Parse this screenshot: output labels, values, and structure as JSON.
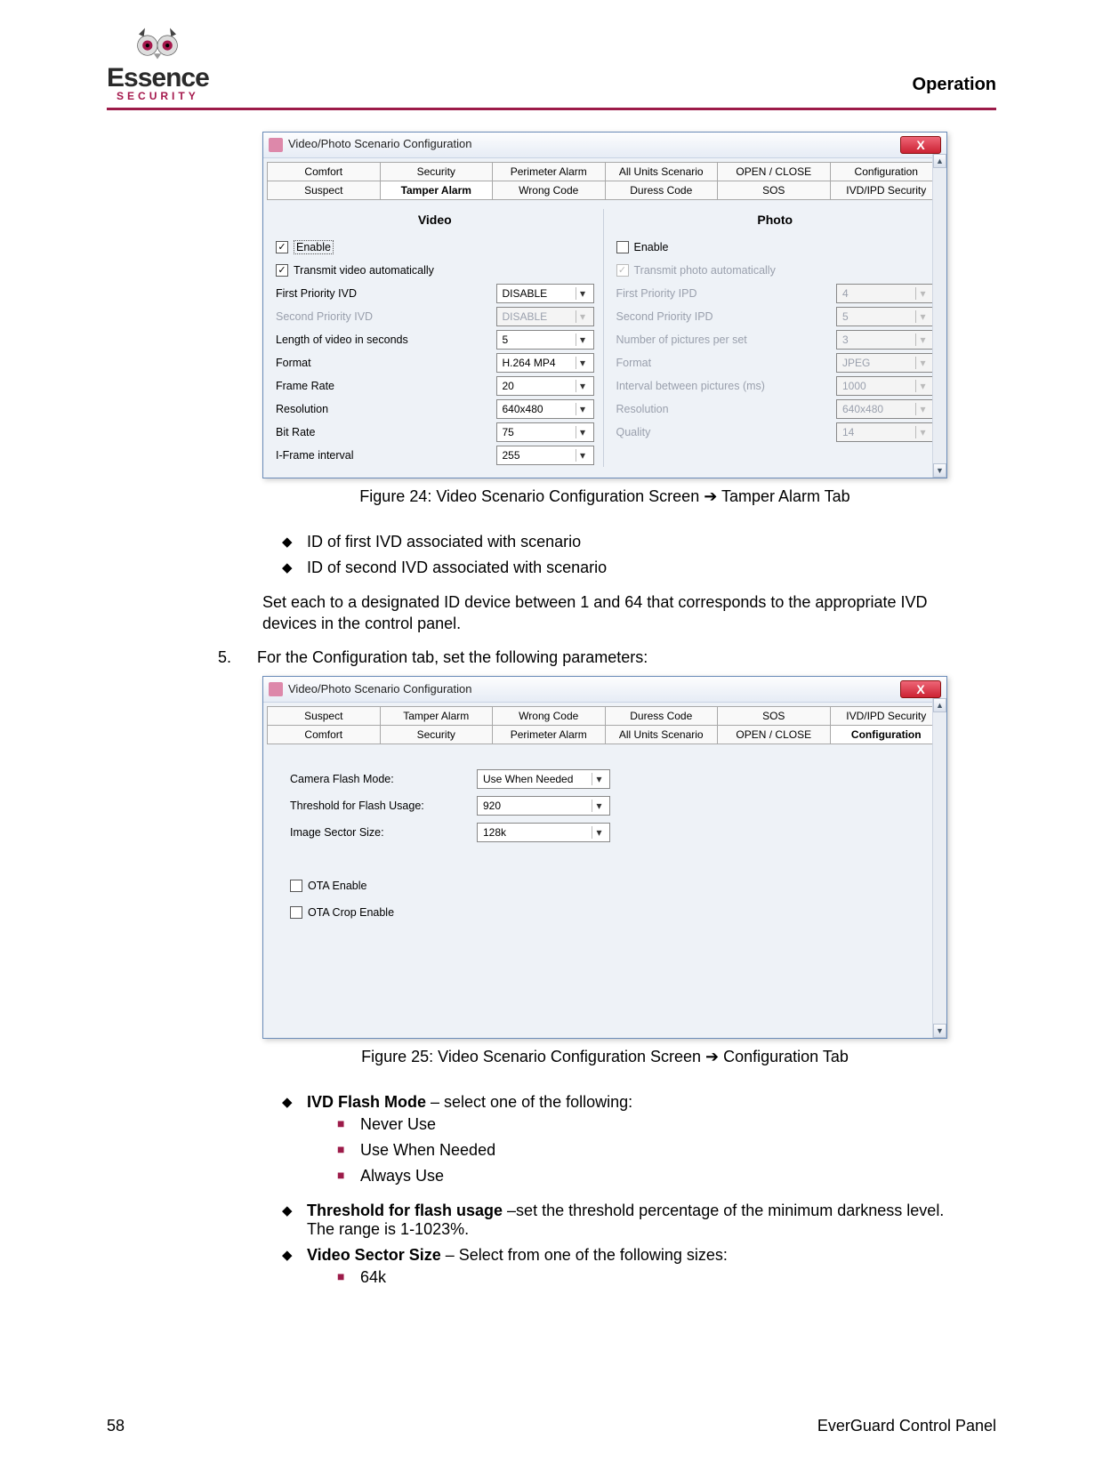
{
  "header": {
    "brand_line1": "Essence",
    "brand_line2": "SECURITY",
    "section": "Operation"
  },
  "dialog1": {
    "title": "Video/Photo Scenario Configuration",
    "tabs_row1": [
      "Comfort",
      "Security",
      "Perimeter Alarm",
      "All Units Scenario",
      "OPEN / CLOSE",
      "Configuration"
    ],
    "tabs_row2": [
      "Suspect",
      "Tamper Alarm",
      "Wrong Code",
      "Duress Code",
      "SOS",
      "IVD/IPD Security"
    ],
    "active_tab": "Tamper Alarm",
    "video": {
      "heading": "Video",
      "enable_label": "Enable",
      "enable_checked": true,
      "transmit_label": "Transmit video automatically",
      "transmit_checked": true,
      "rows": [
        {
          "label": "First Priority IVD",
          "value": "DISABLE",
          "enabled": true
        },
        {
          "label": "Second Priority IVD",
          "value": "DISABLE",
          "enabled": false
        },
        {
          "label": "Length of video in seconds",
          "value": "5",
          "enabled": true
        },
        {
          "label": "Format",
          "value": "H.264 MP4",
          "enabled": true
        },
        {
          "label": "Frame Rate",
          "value": "20",
          "enabled": true
        },
        {
          "label": "Resolution",
          "value": "640x480",
          "enabled": true
        },
        {
          "label": "Bit Rate",
          "value": "75",
          "enabled": true
        },
        {
          "label": "I-Frame interval",
          "value": "255",
          "enabled": true
        }
      ]
    },
    "photo": {
      "heading": "Photo",
      "enable_label": "Enable",
      "enable_checked": false,
      "transmit_label": "Transmit photo automatically",
      "transmit_checked": true,
      "rows": [
        {
          "label": "First Priority IPD",
          "value": "4",
          "enabled": false
        },
        {
          "label": "Second Priority IPD",
          "value": "5",
          "enabled": false
        },
        {
          "label": "Number of pictures per set",
          "value": "3",
          "enabled": false
        },
        {
          "label": "Format",
          "value": "JPEG",
          "enabled": false
        },
        {
          "label": "Interval between pictures (ms)",
          "value": "1000",
          "enabled": false
        },
        {
          "label": "Resolution",
          "value": "640x480",
          "enabled": false
        },
        {
          "label": "Quality",
          "value": "14",
          "enabled": false
        }
      ]
    }
  },
  "caption1": "Figure 24: Video Scenario Configuration Screen ➔ Tamper Alarm Tab",
  "bullets1": [
    "ID of first IVD associated with scenario",
    "ID of second IVD associated with scenario"
  ],
  "para1": "Set each to a designated ID device between 1 and 64 that corresponds to the appropriate IVD devices in the control panel.",
  "num5": {
    "n": "5.",
    "text": "For the Configuration tab, set the following parameters:"
  },
  "dialog2": {
    "title": "Video/Photo Scenario Configuration",
    "tabs_row1": [
      "Suspect",
      "Tamper Alarm",
      "Wrong Code",
      "Duress Code",
      "SOS",
      "IVD/IPD Security"
    ],
    "tabs_row2": [
      "Comfort",
      "Security",
      "Perimeter Alarm",
      "All Units Scenario",
      "OPEN / CLOSE",
      "Configuration"
    ],
    "active_tab": "Configuration",
    "rows": [
      {
        "label": "Camera Flash Mode:",
        "value": "Use When Needed"
      },
      {
        "label": "Threshold for Flash Usage:",
        "value": "920"
      },
      {
        "label": "Image Sector Size:",
        "value": "128k"
      }
    ],
    "checks": [
      {
        "label": "OTA Enable",
        "checked": false
      },
      {
        "label": "OTA Crop Enable",
        "checked": false
      }
    ]
  },
  "caption2": "Figure 25: Video Scenario Configuration Screen ➔ Configuration Tab",
  "section2": {
    "b1_bold": "IVD Flash Mode",
    "b1_rest": " – select one of the following:",
    "subs": [
      "Never Use",
      "Use When Needed",
      "Always Use"
    ],
    "b2_bold": "Threshold for flash usage",
    "b2_rest": " –set the threshold percentage of the minimum darkness level. The range is 1-1023%.",
    "b3_bold": "Video Sector Size",
    "b3_rest": " – Select from one of the following sizes:",
    "subs3": [
      "64k"
    ]
  },
  "footer": {
    "page": "58",
    "doc": "EverGuard Control Panel"
  }
}
